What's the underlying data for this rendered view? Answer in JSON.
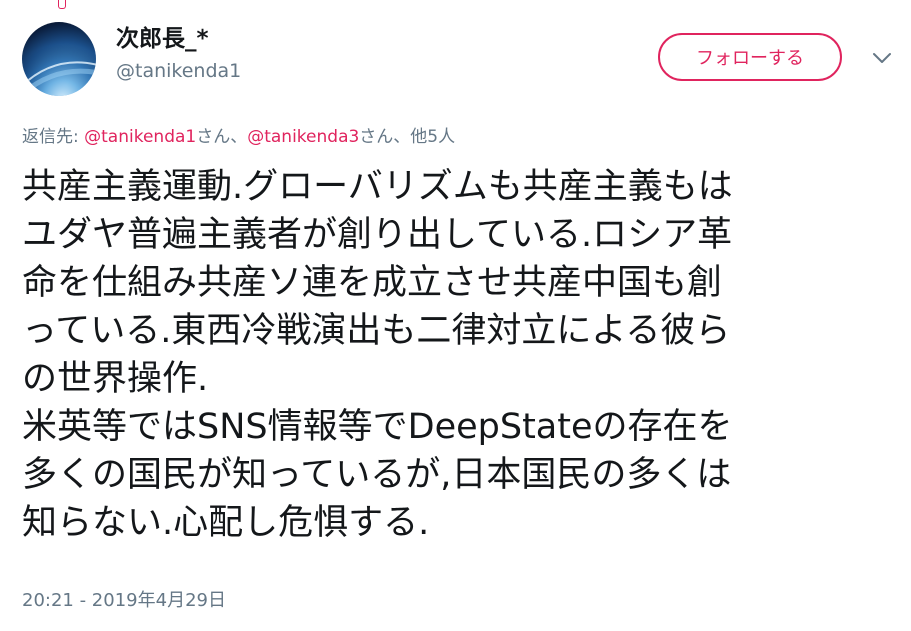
{
  "user": {
    "display_name": "次郎長_*",
    "handle": "@tanikenda1"
  },
  "follow_button": {
    "label": "フォローする"
  },
  "more_icon": "chevron-down-icon",
  "reply_to": {
    "prefix": "返信先: ",
    "mention_1": "@tanikenda1",
    "sep_1": "さん、",
    "mention_2": "@tanikenda3",
    "sep_2": "さん、",
    "others": "他5人"
  },
  "tweet": {
    "lines": [
      "共産主義運動.グローバリズムも共産主義もは",
      "ユダヤ普遍主義者が創り出している.ロシア革",
      "命を仕組み共産ソ連を成立させ共産中国も創",
      "っている.東西冷戦演出も二律対立による彼ら",
      "の世界操作.",
      "米英等ではSNS情報等でDeepStateの存在を",
      "多くの国民が知っているが,日本国民の多くは",
      "知らない.心配し危惧する."
    ]
  },
  "timestamp": "20:21 - 2019年4月29日",
  "colors": {
    "accent": "#e0245e",
    "secondary_text": "#657786",
    "primary_text": "#14171a"
  }
}
